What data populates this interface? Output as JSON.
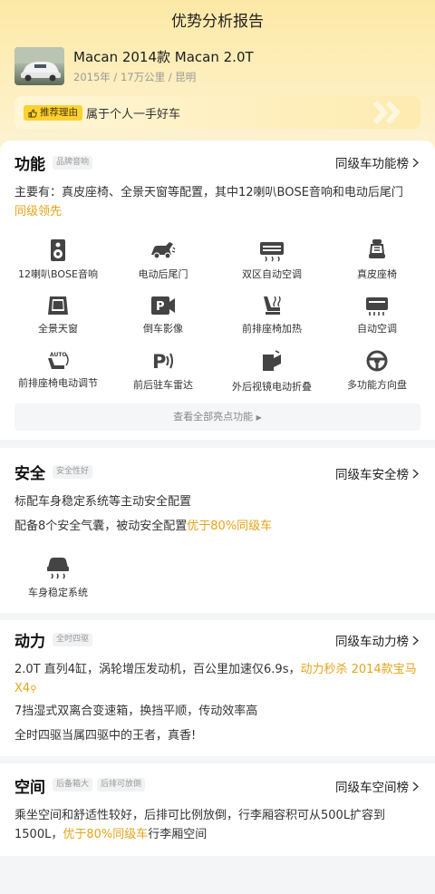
{
  "header": {
    "title": "优势分析报告"
  },
  "car": {
    "name": "Macan 2014款 Macan 2.0T",
    "meta": "2015年 / 17万公里 / 昆明"
  },
  "reason": {
    "tag": "推荐理由",
    "text": "属于个人一手好车"
  },
  "colors": {
    "accent": "#e5a318",
    "tag_yellow": "#fed133"
  },
  "function": {
    "title": "功能",
    "tag": "品牌音响",
    "rank": "同级车功能榜",
    "desc": "主要有：真皮座椅、全景天窗等配置，其中12喇叭BOSE音响和电动后尾门",
    "highlight": "同级领先",
    "features": [
      {
        "icon": "speaker-icon",
        "label": "12喇叭BOSE音响"
      },
      {
        "icon": "power-tailgate-icon",
        "label": "电动后尾门"
      },
      {
        "icon": "dual-zone-ac-icon",
        "label": "双区自动空调"
      },
      {
        "icon": "leather-seat-icon",
        "label": "真皮座椅"
      },
      {
        "icon": "panoramic-sunroof-icon",
        "label": "全景天窗"
      },
      {
        "icon": "reverse-camera-icon",
        "label": "倒车影像"
      },
      {
        "icon": "seat-heating-icon",
        "label": "前排座椅加热"
      },
      {
        "icon": "auto-ac-icon",
        "label": "自动空调"
      },
      {
        "icon": "power-seat-adjust-icon",
        "label": "前排座椅电动调节"
      },
      {
        "icon": "parking-radar-icon",
        "label": "前后驻车雷达"
      },
      {
        "icon": "mirror-fold-icon",
        "label": "外后视镜电动折叠"
      },
      {
        "icon": "steering-wheel-icon",
        "label": "多功能方向盘"
      }
    ],
    "view_all": "查看全部亮点功能"
  },
  "safety": {
    "title": "安全",
    "tag": "安全性好",
    "rank": "同级车安全榜",
    "line1": "标配车身稳定系统等主动安全配置",
    "line2_prefix": "配备8个安全气囊，被动安全配置",
    "line2_highlight": "优于80%同级车",
    "feature": {
      "icon": "stability-control-icon",
      "label": "车身稳定系统"
    }
  },
  "power": {
    "title": "动力",
    "tag": "全时四驱",
    "rank": "同级车动力榜",
    "line1_prefix": "2.0T 直列4缸，涡轮增压发动机，百公里加速仅6.9s，",
    "line1_highlight": "动力秒杀 2014款宝马X4",
    "line2": "7挡湿式双离合变速箱，换挡平顺，传动效率高",
    "line3": "全时四驱当属四驱中的王者，真香!"
  },
  "space": {
    "title": "空间",
    "tags": [
      "后备箱大",
      "后排可放倒"
    ],
    "rank": "同级车空间榜",
    "line1": "乘坐空间和舒适性较好，后排可比例放倒，行李厢容积可从500L扩容到",
    "line2_prefix": "1500L，",
    "line2_highlight": "优于80%同级车",
    "line2_suffix": "行李厢空间"
  }
}
